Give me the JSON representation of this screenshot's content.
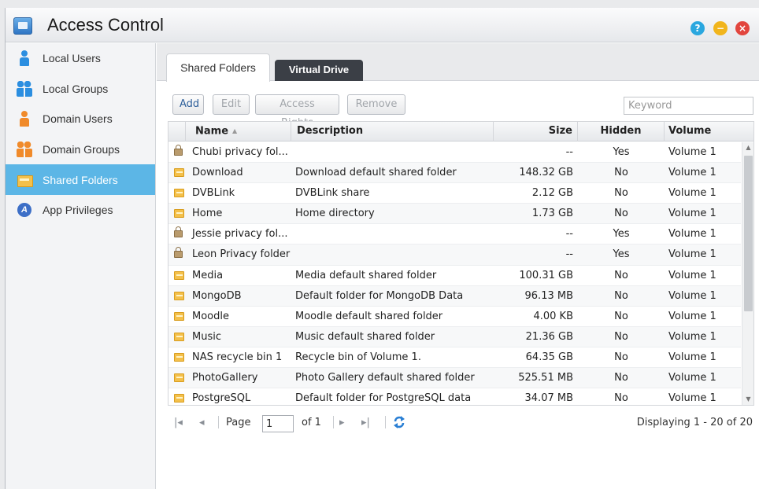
{
  "window": {
    "title": "Access Control",
    "controls": {
      "help": "?",
      "minimize": "−",
      "close": "×"
    }
  },
  "sidebar": {
    "items": [
      {
        "label": "Local Users",
        "icon": "user-icon",
        "active": false
      },
      {
        "label": "Local Groups",
        "icon": "users-icon",
        "active": false
      },
      {
        "label": "Domain Users",
        "icon": "domain-user-icon",
        "active": false
      },
      {
        "label": "Domain Groups",
        "icon": "domain-group-icon",
        "active": false
      },
      {
        "label": "Shared Folders",
        "icon": "folder-icon",
        "active": true
      },
      {
        "label": "App Privileges",
        "icon": "app-icon",
        "active": false
      }
    ]
  },
  "tabs": [
    {
      "label": "Shared Folders",
      "active": true
    },
    {
      "label": "Virtual Drive",
      "active": false
    }
  ],
  "toolbar": {
    "add_label": "Add",
    "edit_label": "Edit",
    "access_rights_label": "Access Rights",
    "remove_label": "Remove",
    "search_placeholder": "Keyword"
  },
  "grid": {
    "columns": {
      "name": "Name",
      "description": "Description",
      "size": "Size",
      "hidden": "Hidden",
      "volume": "Volume"
    },
    "sort": "ascending",
    "rows": [
      {
        "icon": "lock-icon",
        "name": "Chubi privacy fol...",
        "description": "",
        "size": "--",
        "hidden": "Yes",
        "volume": "Volume 1"
      },
      {
        "icon": "folder-icon",
        "name": "Download",
        "description": "Download default shared folder",
        "size": "148.32 GB",
        "hidden": "No",
        "volume": "Volume 1"
      },
      {
        "icon": "folder-icon",
        "name": "DVBLink",
        "description": "DVBLink share",
        "size": "2.12 GB",
        "hidden": "No",
        "volume": "Volume 1"
      },
      {
        "icon": "folder-icon",
        "name": "Home",
        "description": "Home directory",
        "size": "1.73 GB",
        "hidden": "No",
        "volume": "Volume 1"
      },
      {
        "icon": "lock-icon",
        "name": "Jessie privacy fol...",
        "description": "",
        "size": "--",
        "hidden": "Yes",
        "volume": "Volume 1"
      },
      {
        "icon": "lock-icon",
        "name": "Leon Privacy folder",
        "description": "",
        "size": "--",
        "hidden": "Yes",
        "volume": "Volume 1"
      },
      {
        "icon": "folder-icon",
        "name": "Media",
        "description": "Media default shared folder",
        "size": "100.31 GB",
        "hidden": "No",
        "volume": "Volume 1"
      },
      {
        "icon": "folder-icon",
        "name": "MongoDB",
        "description": "Default folder for MongoDB Data",
        "size": "96.13 MB",
        "hidden": "No",
        "volume": "Volume 1"
      },
      {
        "icon": "folder-icon",
        "name": "Moodle",
        "description": "Moodle default shared folder",
        "size": "4.00 KB",
        "hidden": "No",
        "volume": "Volume 1"
      },
      {
        "icon": "folder-icon",
        "name": "Music",
        "description": "Music default shared folder",
        "size": "21.36 GB",
        "hidden": "No",
        "volume": "Volume 1"
      },
      {
        "icon": "folder-icon",
        "name": "NAS recycle bin 1",
        "description": "Recycle bin of Volume 1.",
        "size": "64.35 GB",
        "hidden": "No",
        "volume": "Volume 1"
      },
      {
        "icon": "folder-icon",
        "name": "PhotoGallery",
        "description": "Photo Gallery default shared folder",
        "size": "525.51 MB",
        "hidden": "No",
        "volume": "Volume 1"
      },
      {
        "icon": "folder-icon",
        "name": "PostgreSQL",
        "description": "Default folder for PostgreSQL data",
        "size": "34.07 MB",
        "hidden": "No",
        "volume": "Volume 1"
      }
    ]
  },
  "pager": {
    "page_label": "Page",
    "page_value": "1",
    "of_label": "of 1",
    "displaying": "Displaying 1 - 20 of 20"
  },
  "colors": {
    "accent": "#5cb6e6",
    "tab_dark": "#3b3f46",
    "folder": "#f4c04a",
    "close": "#e2463e",
    "minimize": "#f1b51c",
    "help": "#2aa7df"
  }
}
